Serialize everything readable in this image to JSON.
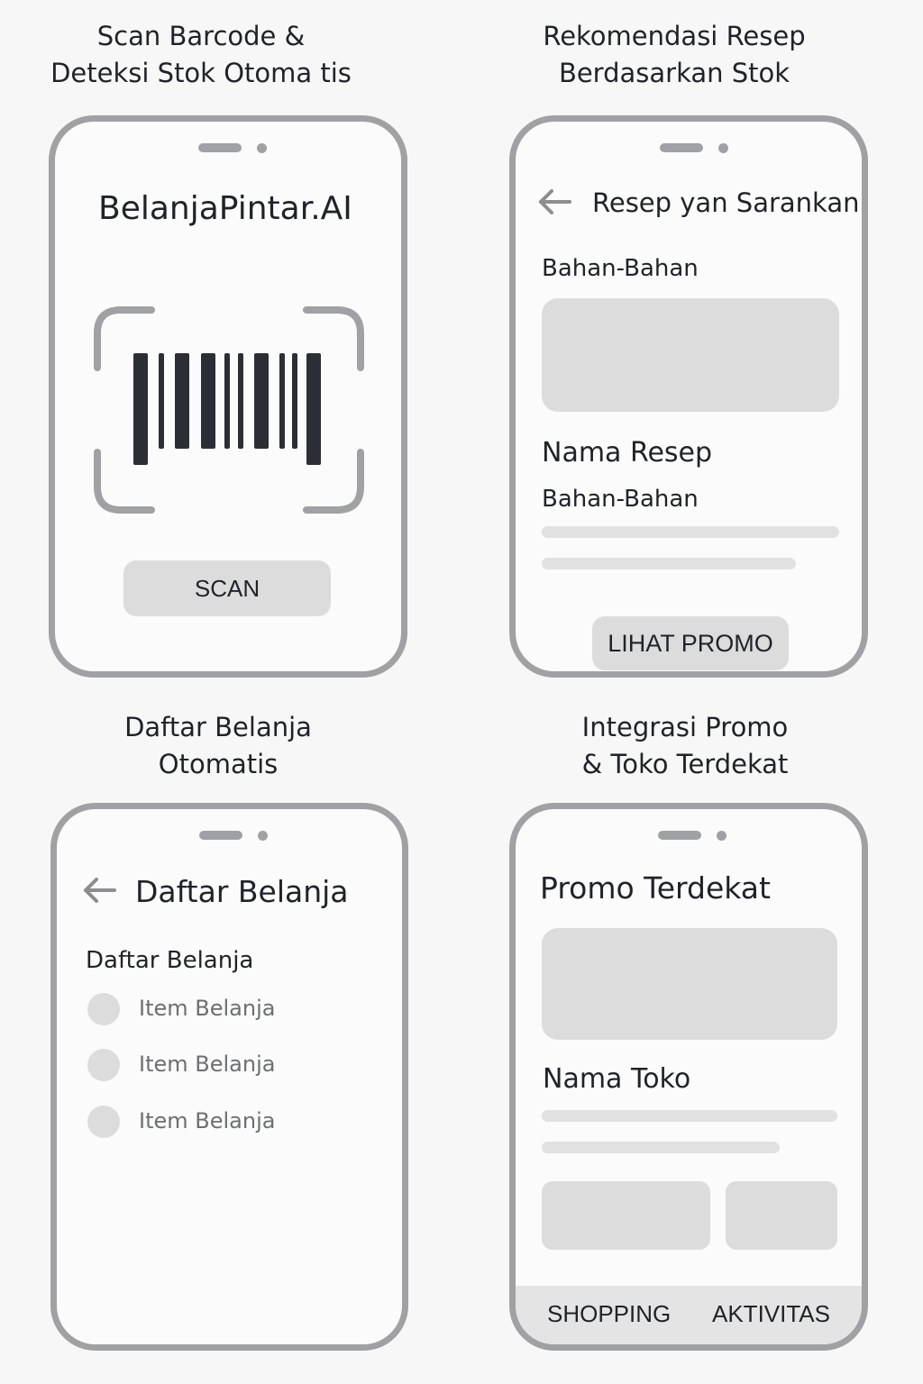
{
  "captions": {
    "scan": {
      "line1": "Scan Barcode &",
      "line2": "Deteksi Stok Otoma tis"
    },
    "recipe": {
      "line1": "Rekomendasi Resep",
      "line2": "Berdasarkan Stok"
    },
    "list": {
      "line1": "Daftar Belanja",
      "line2": "Otomatis"
    },
    "promo": {
      "line1": "Integrasi Promo",
      "line2": "& Toko Terdekat"
    }
  },
  "scan_screen": {
    "app_title": "BelanjaPintar.AI",
    "scan_button": "SCAN"
  },
  "recipe_screen": {
    "header_title": "Resep yan Sarankan",
    "ingredients_heading": "Bahan-Bahan",
    "recipe_name": "Nama Resep",
    "recipe_ingredients": "Bahan-Bahan",
    "promo_button": "LIHAT PROMO"
  },
  "list_screen": {
    "header_title": "Daftar Belanja",
    "section_heading": "Daftar Belanja",
    "items": [
      {
        "label": "Item Belanja"
      },
      {
        "label": "Item Belanja"
      },
      {
        "label": "Item Belanja"
      }
    ]
  },
  "promo_screen": {
    "title": "Promo Terdekat",
    "store_name": "Nama Toko",
    "tabs": [
      {
        "label": "SHOPPING"
      },
      {
        "label": "AKTIVITAS"
      }
    ]
  },
  "colors": {
    "background": "#f7f7f7",
    "phone_frame": "#a0a1a4",
    "placeholder": "#dcdcdd",
    "barcode": "#2b2f35",
    "text": "#1f2329"
  },
  "icons": [
    "back-arrow-icon",
    "barcode-icon",
    "scan-frame-icon"
  ]
}
